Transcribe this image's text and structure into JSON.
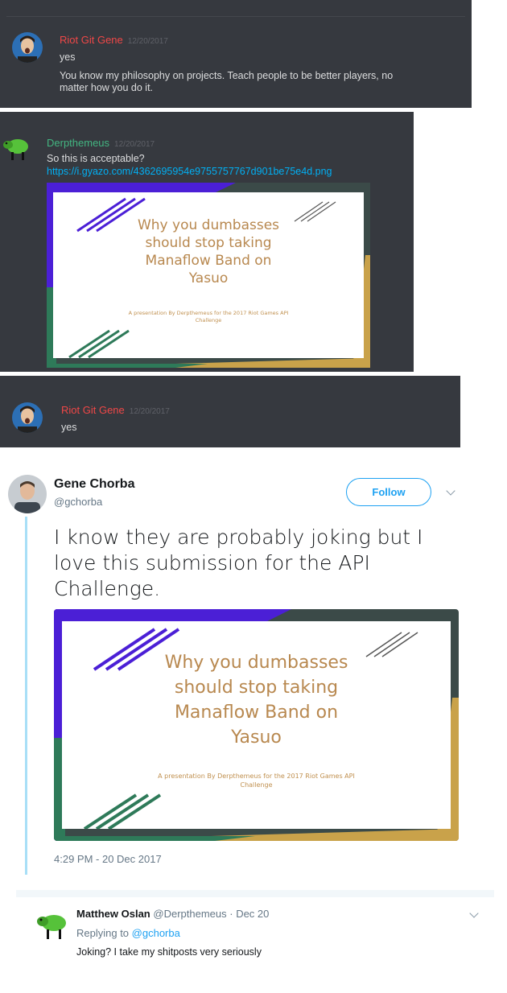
{
  "discord": {
    "msg1": {
      "username": "Riot Git Gene",
      "timestamp": "12/20/2017",
      "line1": "yes",
      "line2": "You know my philosophy on projects. Teach people to be better players, no",
      "line3": "matter how you do it."
    },
    "msg2": {
      "username": "Derpthemeus",
      "timestamp": "12/20/2017",
      "text": "So this is acceptable?",
      "link": "https://i.gyazo.com/4362695954e9755757767d901be75e4d.png"
    },
    "msg3": {
      "username": "Riot Git Gene",
      "timestamp": "12/20/2017",
      "text": "yes"
    }
  },
  "slide": {
    "title_line1": "Why you dumbasses",
    "title_line2": "should stop taking",
    "title_line3": "Manaflow Band on",
    "title_line4": "Yasuo",
    "subtitle_line1": "A presentation By Derpthemeus for the 2017 Riot Games API",
    "subtitle_line2": "Challenge"
  },
  "tweet": {
    "name": "Gene Chorba",
    "handle": "@gchorba",
    "follow_label": "Follow",
    "text_line1": "I know they are probably joking but I",
    "text_line2": "love this submission for the API",
    "text_line3": "Challenge.",
    "timestamp": "4:29 PM - 20 Dec 2017"
  },
  "reply": {
    "name": "Matthew Oslan",
    "handle": "@Derpthemeus",
    "date": "· Dec 20",
    "replying_prefix": "Replying to",
    "replying_to": "@gchorba",
    "text": "Joking? I take my shitposts very seriously"
  },
  "colors": {
    "discord_bg": "#36393f",
    "riot_red": "#f04747",
    "derp_green": "#43b581",
    "link_blue": "#00b0f4",
    "twitter_blue": "#1da1f2"
  }
}
